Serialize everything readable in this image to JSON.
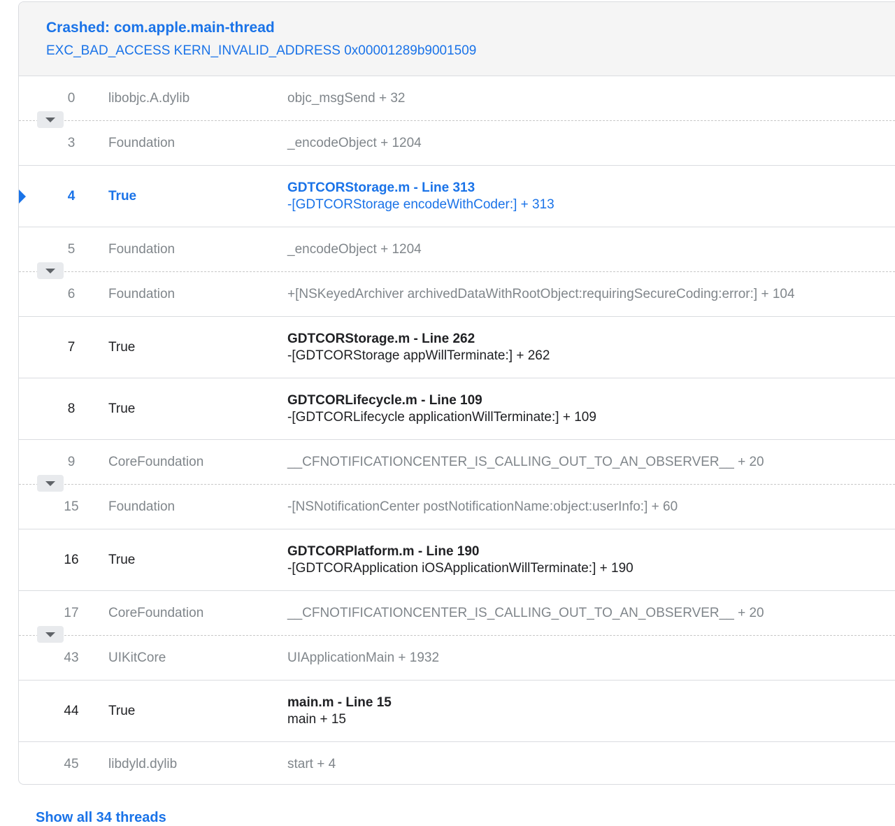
{
  "header": {
    "title": "Crashed: com.apple.main-thread",
    "subtitle": "EXC_BAD_ACCESS KERN_INVALID_ADDRESS 0x00001289b9001509"
  },
  "frames": [
    {
      "num": "0",
      "lib": "libobjc.A.dylib",
      "symbol": "objc_msgSend + 32"
    },
    {
      "num": "3",
      "lib": "Foundation",
      "symbol": "_encodeObject + 1204"
    },
    {
      "num": "4",
      "lib": "True",
      "file_line": "GDTCORStorage.m - Line 313",
      "symbol": "-[GDTCORStorage encodeWithCoder:] + 313"
    },
    {
      "num": "5",
      "lib": "Foundation",
      "symbol": "_encodeObject + 1204"
    },
    {
      "num": "6",
      "lib": "Foundation",
      "symbol": "+[NSKeyedArchiver archivedDataWithRootObject:requiringSecureCoding:error:] + 104"
    },
    {
      "num": "7",
      "lib": "True",
      "file_line": "GDTCORStorage.m - Line 262",
      "symbol": "-[GDTCORStorage appWillTerminate:] + 262"
    },
    {
      "num": "8",
      "lib": "True",
      "file_line": "GDTCORLifecycle.m - Line 109",
      "symbol": "-[GDTCORLifecycle applicationWillTerminate:] + 109"
    },
    {
      "num": "9",
      "lib": "CoreFoundation",
      "symbol": "__CFNOTIFICATIONCENTER_IS_CALLING_OUT_TO_AN_OBSERVER__ + 20"
    },
    {
      "num": "15",
      "lib": "Foundation",
      "symbol": "-[NSNotificationCenter postNotificationName:object:userInfo:] + 60"
    },
    {
      "num": "16",
      "lib": "True",
      "file_line": "GDTCORPlatform.m - Line 190",
      "symbol": "-[GDTCORApplication iOSApplicationWillTerminate:] + 190"
    },
    {
      "num": "17",
      "lib": "CoreFoundation",
      "symbol": "__CFNOTIFICATIONCENTER_IS_CALLING_OUT_TO_AN_OBSERVER__ + 20"
    },
    {
      "num": "43",
      "lib": "UIKitCore",
      "symbol": "UIApplicationMain + 1932"
    },
    {
      "num": "44",
      "lib": "True",
      "file_line": "main.m - Line 15",
      "symbol": "main + 15"
    },
    {
      "num": "45",
      "lib": "libdyld.dylib",
      "symbol": "start + 4"
    }
  ],
  "footer": {
    "show_all_threads": "Show all 34 threads"
  },
  "colors": {
    "accent": "#1a73e8",
    "dim_text": "#80868b",
    "normal_text": "#202124",
    "header_bg": "#f5f5f5"
  }
}
